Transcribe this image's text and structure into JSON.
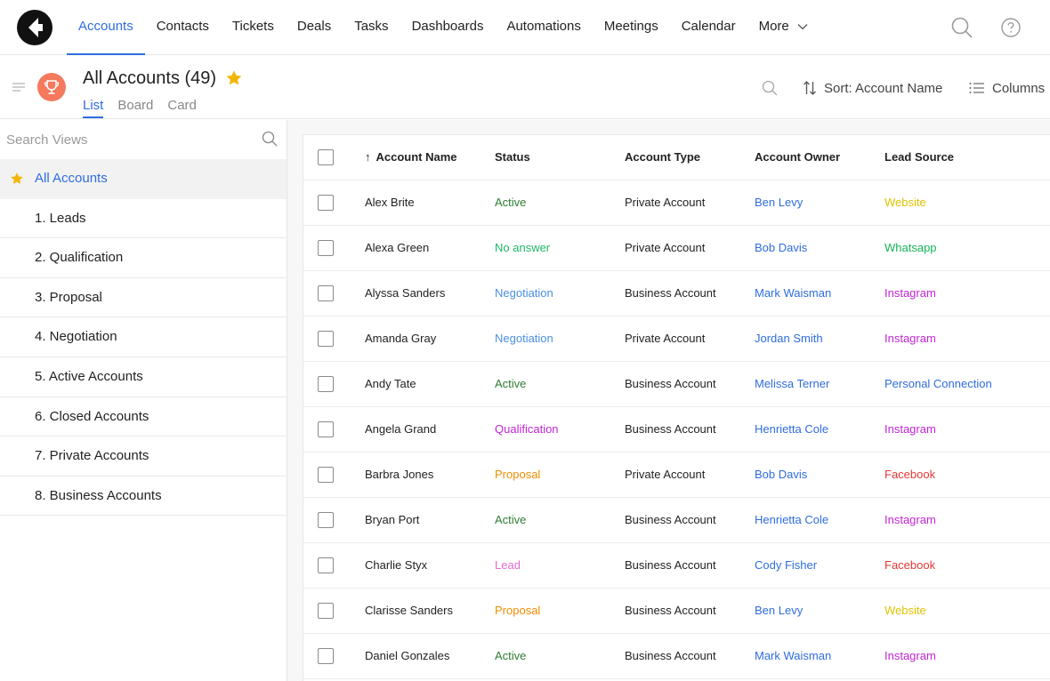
{
  "nav": {
    "items": [
      {
        "label": "Accounts",
        "active": true
      },
      {
        "label": "Contacts"
      },
      {
        "label": "Tickets"
      },
      {
        "label": "Deals"
      },
      {
        "label": "Tasks"
      },
      {
        "label": "Dashboards"
      },
      {
        "label": "Automations"
      },
      {
        "label": "Meetings"
      },
      {
        "label": "Calendar"
      }
    ],
    "more_label": "More",
    "accent": "#2f6de0"
  },
  "view": {
    "title": "All Accounts (49)",
    "tabs": [
      "List",
      "Board",
      "Card"
    ],
    "active_tab": "List",
    "sort_label": "Sort: Account Name",
    "columns_label": "Columns",
    "icon_color": "#f4795d"
  },
  "sidebar": {
    "search_placeholder": "Search Views",
    "items": [
      "All Accounts",
      "1. Leads",
      "2. Qualification",
      "3. Proposal",
      "4. Negotiation",
      "5. Active Accounts",
      "6. Closed Accounts",
      "7. Private Accounts",
      "8. Business Accounts"
    ]
  },
  "table": {
    "headers": {
      "name": "Account Name",
      "status": "Status",
      "type": "Account Type",
      "owner": "Account Owner",
      "source": "Lead Source"
    },
    "rows": [
      {
        "name": "Alex Brite",
        "status": "Active",
        "type": "Private Account",
        "owner": "Ben Levy",
        "source": "Website"
      },
      {
        "name": "Alexa Green",
        "status": "No answer",
        "type": "Private Account",
        "owner": "Bob Davis",
        "source": "Whatsapp"
      },
      {
        "name": "Alyssa Sanders",
        "status": "Negotiation",
        "type": "Business Account",
        "owner": "Mark Waisman",
        "source": "Instagram"
      },
      {
        "name": "Amanda Gray",
        "status": "Negotiation",
        "type": "Private Account",
        "owner": "Jordan Smith",
        "source": "Instagram"
      },
      {
        "name": "Andy Tate",
        "status": "Active",
        "type": "Business Account",
        "owner": "Melissa Terner",
        "source": "Personal Connection"
      },
      {
        "name": "Angela Grand",
        "status": "Qualification",
        "type": "Business Account",
        "owner": "Henrietta Cole",
        "source": "Instagram"
      },
      {
        "name": "Barbra Jones",
        "status": "Proposal",
        "type": "Private Account",
        "owner": "Bob Davis",
        "source": "Facebook"
      },
      {
        "name": "Bryan Port",
        "status": "Active",
        "type": "Business Account",
        "owner": "Henrietta Cole",
        "source": "Instagram"
      },
      {
        "name": "Charlie Styx",
        "status": "Lead",
        "type": "Business Account",
        "owner": "Cody Fisher",
        "source": "Facebook"
      },
      {
        "name": "Clarisse Sanders",
        "status": "Proposal",
        "type": "Business Account",
        "owner": "Ben Levy",
        "source": "Website"
      },
      {
        "name": "Daniel Gonzales",
        "status": "Active",
        "type": "Business Account",
        "owner": "Mark Waisman",
        "source": "Instagram"
      }
    ]
  },
  "colors": {
    "status": {
      "Active": "#2e7d32",
      "No answer": "#1fb86a",
      "Negotiation": "#4a90e2",
      "Qualification": "#c026d3",
      "Proposal": "#f08c00",
      "Lead": "#e46ad0"
    },
    "source": {
      "Website": "#e2c400",
      "Whatsapp": "#17b35a",
      "Instagram": "#c026d3",
      "Personal Connection": "#2f6de0",
      "Facebook": "#e53935"
    }
  }
}
